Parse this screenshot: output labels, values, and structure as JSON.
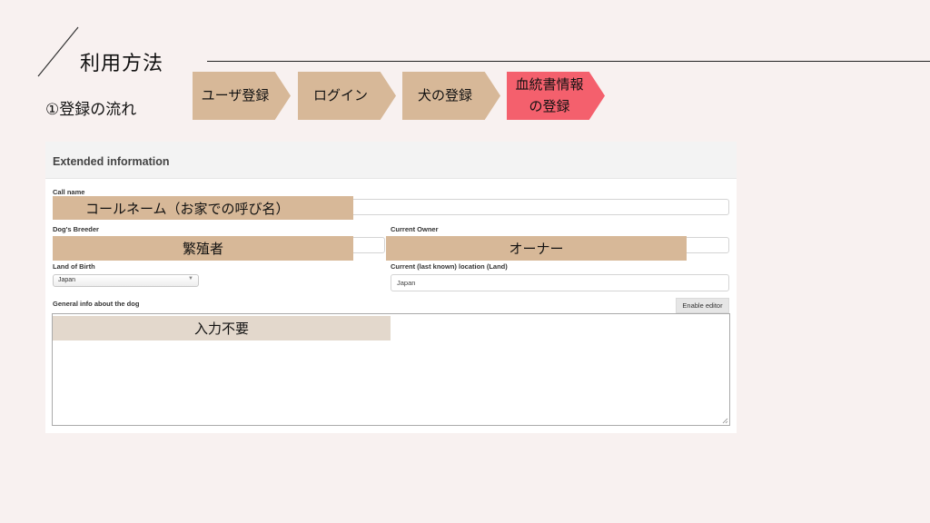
{
  "page": {
    "title": "利用方法",
    "subtitle": "①登録の流れ"
  },
  "steps": [
    {
      "label": "ユーザ登録",
      "color": "#d7b898",
      "active": false
    },
    {
      "label": "ログイン",
      "color": "#d7b898",
      "active": false
    },
    {
      "label": "犬の登録",
      "color": "#d7b898",
      "active": false
    },
    {
      "label": "血統書情報\nの登録",
      "color": "#f4606d",
      "active": true
    }
  ],
  "form": {
    "panel_title": "Extended information",
    "call_name_label": "Call name",
    "call_name_value": "",
    "breeder_label": "Dog's Breeder",
    "breeder_value": "",
    "owner_label": "Current Owner",
    "owner_value": "",
    "land_of_birth_label": "Land of Birth",
    "land_of_birth_value": "Japan",
    "location_label": "Current (last known) location (Land)",
    "location_value": "Japan",
    "general_info_label": "General info about the dog",
    "enable_editor_label": "Enable editor",
    "general_info_value": ""
  },
  "annotations": {
    "call_name": "コールネーム（お家での呼び名）",
    "breeder": "繁殖者",
    "owner": "オーナー",
    "general_info": "入力不要"
  },
  "colors": {
    "background": "#f8f1f0",
    "step_default": "#d7b898",
    "step_active": "#f4606d",
    "annotation": "#d7b898",
    "annotation_light": "#e3d8cc"
  }
}
